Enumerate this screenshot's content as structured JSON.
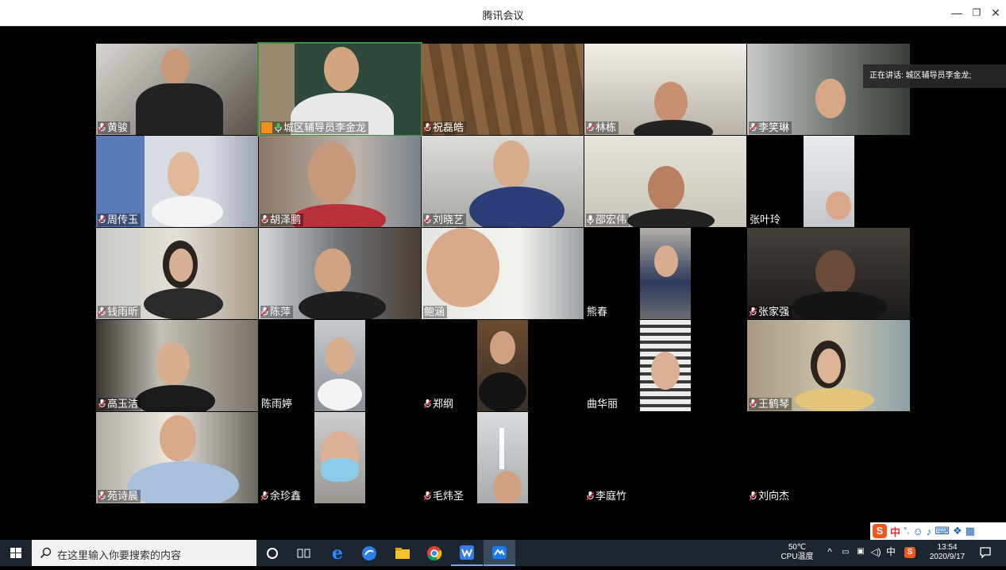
{
  "window": {
    "title": "腾讯会议",
    "minimize": "—",
    "restore": "❐",
    "close": "✕"
  },
  "speaking_tip": "正在讲话: 城区辅导员李金龙;",
  "participants": [
    {
      "name": "黄骏",
      "mic": "muted"
    },
    {
      "name": "城区辅导员李金龙",
      "mic": "on",
      "host": true
    },
    {
      "name": "祝磊皓",
      "mic": "muted"
    },
    {
      "name": "林栋",
      "mic": "muted"
    },
    {
      "name": "李笑琳",
      "mic": "muted"
    },
    {
      "name": "周传玉",
      "mic": "muted"
    },
    {
      "name": "胡泽鹏",
      "mic": "muted"
    },
    {
      "name": "刘晓艺",
      "mic": "muted"
    },
    {
      "name": "邵宏伟",
      "mic": "on"
    },
    {
      "name": "张叶玲",
      "mic": "none"
    },
    {
      "name": "钱雨昕",
      "mic": "muted"
    },
    {
      "name": "陈萍",
      "mic": "muted"
    },
    {
      "name": "鲍涵",
      "mic": "none"
    },
    {
      "name": "熊春",
      "mic": "none"
    },
    {
      "name": "张家强",
      "mic": "muted"
    },
    {
      "name": "高玉洁",
      "mic": "muted"
    },
    {
      "name": "陈雨婷",
      "mic": "none"
    },
    {
      "name": "郑纲",
      "mic": "muted"
    },
    {
      "name": "曲华丽",
      "mic": "none"
    },
    {
      "name": "王鹤琴",
      "mic": "muted"
    },
    {
      "name": "苑诗晨",
      "mic": "muted"
    },
    {
      "name": "余珍鑫",
      "mic": "muted"
    },
    {
      "name": "毛炜圣",
      "mic": "muted"
    },
    {
      "name": "李庭竹",
      "mic": "muted"
    },
    {
      "name": "刘向杰",
      "mic": "muted"
    }
  ],
  "ime": {
    "lang": "中",
    "punct": "°,"
  },
  "taskbar": {
    "search_placeholder": "在这里输入你要搜索的内容",
    "temperature": "50℃",
    "temp_label": "CPU温度",
    "ime_lang": "中",
    "time": "13:54",
    "date": "2020/9/17"
  },
  "colors": {
    "accent_green": "#3c8f3c",
    "muted_red": "#e0303a",
    "taskbar": "#1d2630"
  }
}
